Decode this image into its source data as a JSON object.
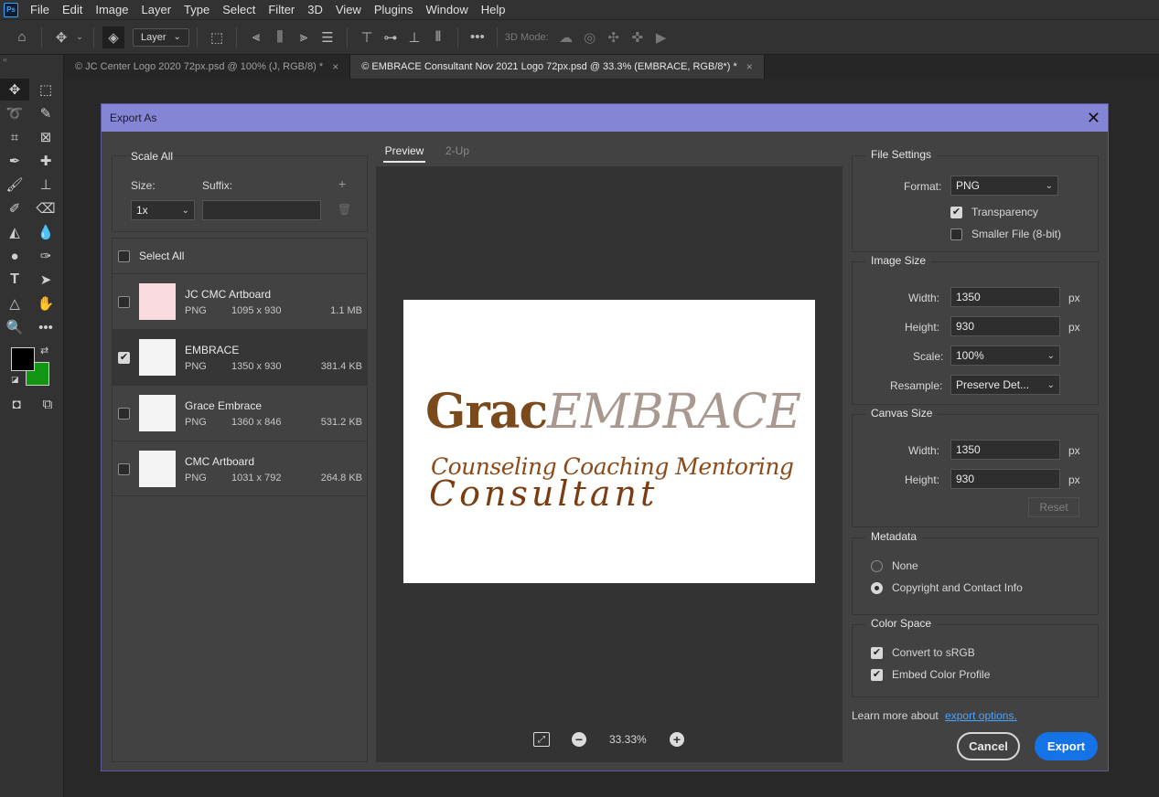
{
  "app": {
    "logo_text": "Ps",
    "menu": [
      "File",
      "Edit",
      "Image",
      "Layer",
      "Type",
      "Select",
      "Filter",
      "3D",
      "View",
      "Plugins",
      "Window",
      "Help"
    ]
  },
  "options_bar": {
    "layer_select": "Layer",
    "three_d_mode": "3D Mode:"
  },
  "tabs": [
    {
      "label": "© JC Center Logo 2020 72px.psd @ 100% (J, RGB/8) *",
      "active": false
    },
    {
      "label": "© EMBRACE Consultant Nov 2021 Logo 72px.psd @ 33.3% (EMBRACE, RGB/8*) *",
      "active": true
    }
  ],
  "colors": {
    "foreground": "#000000",
    "background": "#129512",
    "dialog_titlebar": "#8585d6",
    "export_button": "#1473e6"
  },
  "dialog": {
    "title": "Export As",
    "scale_all": {
      "title": "Scale All",
      "size_label": "Size:",
      "suffix_label": "Suffix:",
      "size_value": "1x",
      "suffix_value": ""
    },
    "select_all": "Select All",
    "assets": [
      {
        "name": "JC CMC Artboard",
        "format": "PNG",
        "dims": "1095 x 930",
        "size": "1.1 MB",
        "checked": false
      },
      {
        "name": "EMBRACE",
        "format": "PNG",
        "dims": "1350 x 930",
        "size": "381.4 KB",
        "checked": true
      },
      {
        "name": "Grace Embrace",
        "format": "PNG",
        "dims": "1360 x 846",
        "size": "531.2 KB",
        "checked": false
      },
      {
        "name": "CMC Artboard",
        "format": "PNG",
        "dims": "1031 x 792",
        "size": "264.8 KB",
        "checked": false
      }
    ],
    "preview": {
      "tabs": [
        "Preview",
        "2-Up"
      ],
      "zoom": "33.33%",
      "logo_line1_a": "Grac",
      "logo_line1_b": "EMBRACE",
      "logo_line2": "Counseling Coaching Mentoring",
      "logo_line3": "Consultant"
    },
    "file_settings": {
      "title": "File Settings",
      "format_label": "Format:",
      "format_value": "PNG",
      "transparency": "Transparency",
      "smaller_file": "Smaller File (8-bit)"
    },
    "image_size": {
      "title": "Image Size",
      "width_label": "Width:",
      "width_value": "1350",
      "height_label": "Height:",
      "height_value": "930",
      "scale_label": "Scale:",
      "scale_value": "100%",
      "resample_label": "Resample:",
      "resample_value": "Preserve Det...",
      "unit": "px"
    },
    "canvas_size": {
      "title": "Canvas Size",
      "width_label": "Width:",
      "width_value": "1350",
      "height_label": "Height:",
      "height_value": "930",
      "unit": "px",
      "reset": "Reset"
    },
    "metadata": {
      "title": "Metadata",
      "none": "None",
      "copyright": "Copyright and Contact Info"
    },
    "color_space": {
      "title": "Color Space",
      "convert": "Convert to sRGB",
      "embed": "Embed Color Profile"
    },
    "learn_more": "Learn more about",
    "export_options_link": "export options.",
    "cancel": "Cancel",
    "export": "Export"
  }
}
